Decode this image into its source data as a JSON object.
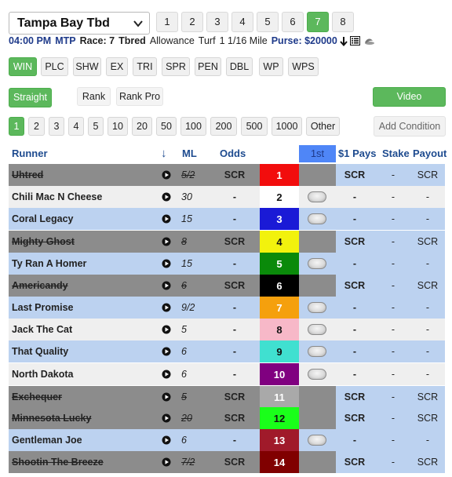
{
  "header": {
    "track": "Tampa Bay Tbd",
    "race_tabs": [
      "1",
      "2",
      "3",
      "4",
      "5",
      "6",
      "7",
      "8"
    ],
    "active_race": "7",
    "post_time": "04:00 PM",
    "mtp_label": "MTP",
    "race_label": "Race: 7",
    "breed": "Tbred",
    "race_type": "Allowance",
    "surface": "Turf",
    "distance": "1 1/16 Mile",
    "purse_label": "Purse: $20000"
  },
  "pools": [
    "WIN",
    "PLC",
    "SHW",
    "EX",
    "TRI",
    "SPR",
    "PEN",
    "DBL",
    "WP",
    "WPS"
  ],
  "active_pool": "WIN",
  "bet_modes": {
    "straight": "Straight",
    "rank": "Rank",
    "rank_pro": "Rank Pro",
    "video": "Video"
  },
  "amounts": [
    "1",
    "2",
    "3",
    "4",
    "5",
    "10",
    "20",
    "50",
    "100",
    "200",
    "500",
    "1000",
    "Other"
  ],
  "active_amount": "1",
  "add_condition": "Add Condition",
  "table_headers": {
    "runner": "Runner",
    "sort": "↓",
    "ml": "ML",
    "odds": "Odds",
    "first": "1st",
    "pays": "$1 Pays",
    "stake": "Stake",
    "payout": "Payout"
  },
  "colors": {
    "accent_green": "#5cb85c",
    "header_blue": "#4f86f7",
    "row_blue": "#bcd2f0",
    "row_grey": "#efefef",
    "scratched": "#8c8c8c"
  },
  "runners": [
    {
      "name": "Uhtred",
      "ml": "5/2",
      "odds": "SCR",
      "num": "1",
      "num_bg": "#f20d0d",
      "num_color": "#ffffff",
      "pays": "SCR",
      "stake": "-",
      "payout": "SCR",
      "scratched": true
    },
    {
      "name": "Chili Mac N Cheese",
      "ml": "30",
      "odds": "-",
      "num": "2",
      "num_bg": "#ffffff",
      "num_color": "#111111",
      "pays": "-",
      "stake": "-",
      "payout": "-",
      "scratched": false
    },
    {
      "name": "Coral Legacy",
      "ml": "15",
      "odds": "-",
      "num": "3",
      "num_bg": "#1a1ad6",
      "num_color": "#ffffff",
      "pays": "-",
      "stake": "-",
      "payout": "-",
      "scratched": false
    },
    {
      "name": "Mighty Ghost",
      "ml": "8",
      "odds": "SCR",
      "num": "4",
      "num_bg": "#f2f20d",
      "num_color": "#111111",
      "pays": "SCR",
      "stake": "-",
      "payout": "SCR",
      "scratched": true
    },
    {
      "name": "Ty Ran A Homer",
      "ml": "15",
      "odds": "-",
      "num": "5",
      "num_bg": "#0a8a0a",
      "num_color": "#ffffff",
      "pays": "-",
      "stake": "-",
      "payout": "-",
      "scratched": false
    },
    {
      "name": "Americandy",
      "ml": "6",
      "odds": "SCR",
      "num": "6",
      "num_bg": "#000000",
      "num_color": "#ffffff",
      "pays": "SCR",
      "stake": "-",
      "payout": "SCR",
      "scratched": true
    },
    {
      "name": "Last Promise",
      "ml": "9/2",
      "odds": "-",
      "num": "7",
      "num_bg": "#f5a00d",
      "num_color": "#ffffff",
      "pays": "-",
      "stake": "-",
      "payout": "-",
      "scratched": false
    },
    {
      "name": "Jack The Cat",
      "ml": "5",
      "odds": "-",
      "num": "8",
      "num_bg": "#f7b8c8",
      "num_color": "#111111",
      "pays": "-",
      "stake": "-",
      "payout": "-",
      "scratched": false
    },
    {
      "name": "That Quality",
      "ml": "6",
      "odds": "-",
      "num": "9",
      "num_bg": "#40e0d0",
      "num_color": "#111111",
      "pays": "-",
      "stake": "-",
      "payout": "-",
      "scratched": false
    },
    {
      "name": "North Dakota",
      "ml": "6",
      "odds": "-",
      "num": "10",
      "num_bg": "#800080",
      "num_color": "#ffffff",
      "pays": "-",
      "stake": "-",
      "payout": "-",
      "scratched": false
    },
    {
      "name": "Exchequer",
      "ml": "5",
      "odds": "SCR",
      "num": "11",
      "num_bg": "#a9a9a9",
      "num_color": "#ffffff",
      "pays": "SCR",
      "stake": "-",
      "payout": "SCR",
      "scratched": true
    },
    {
      "name": "Minnesota Lucky",
      "ml": "20",
      "odds": "SCR",
      "num": "12",
      "num_bg": "#1aff1a",
      "num_color": "#111111",
      "pays": "SCR",
      "stake": "-",
      "payout": "SCR",
      "scratched": true
    },
    {
      "name": "Gentleman Joe",
      "ml": "6",
      "odds": "-",
      "num": "13",
      "num_bg": "#a01a2a",
      "num_color": "#ffffff",
      "pays": "-",
      "stake": "-",
      "payout": "-",
      "scratched": false
    },
    {
      "name": "Shootin The Breeze",
      "ml": "7/2",
      "odds": "SCR",
      "num": "14",
      "num_bg": "#800000",
      "num_color": "#ffffff",
      "pays": "SCR",
      "stake": "-",
      "payout": "SCR",
      "scratched": true
    }
  ]
}
